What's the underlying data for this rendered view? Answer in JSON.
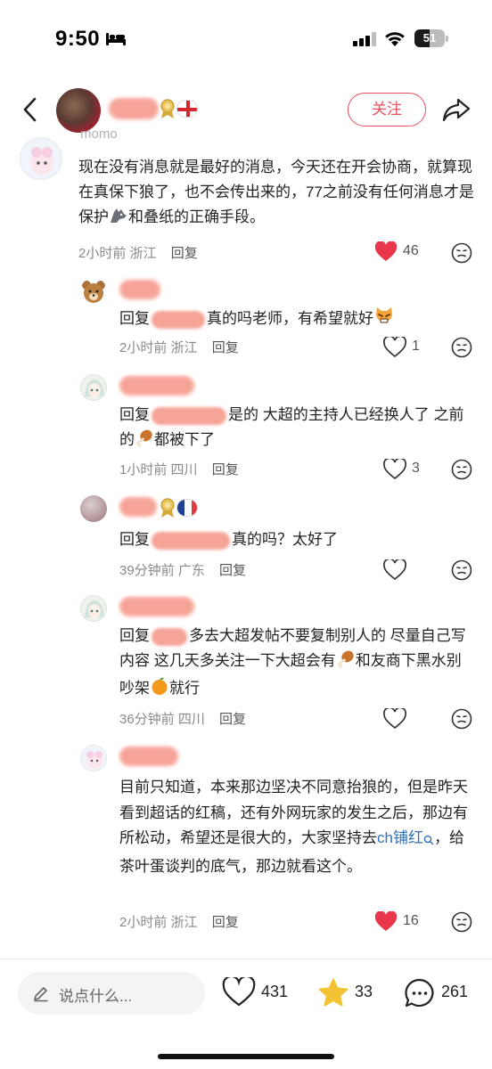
{
  "status_bar": {
    "time": "9:50",
    "battery": "51",
    "battery_level": 0.51
  },
  "header": {
    "follow_label": "关注"
  },
  "comments": [
    {
      "partial_name": "momo",
      "text": "现在没有消息就是最好的消息，今天还在开会协商，就算现在真保下狼了，也不会传出来的，77之前没有任何消息才是保护",
      "text_after_emoji": "和叠纸的正确手段。",
      "time": "2小时前",
      "location": "浙江",
      "reply_label": "回复",
      "likes": "46",
      "liked": true
    },
    {
      "reply_prefix": "回复",
      "text": "真的吗老师，有希望就好",
      "time": "2小时前",
      "location": "浙江",
      "reply_label": "回复",
      "likes": "1",
      "liked": false
    },
    {
      "reply_prefix": "回复",
      "text": "是的 大超的主持人已经换人了 之前的",
      "text_after_emoji": "都被下了",
      "time": "1小时前",
      "location": "四川",
      "reply_label": "回复",
      "likes": "3",
      "liked": false
    },
    {
      "reply_prefix": "回复",
      "text": "真的吗？太好了",
      "time": "39分钟前",
      "location": "广东",
      "reply_label": "回复",
      "likes": "",
      "liked": false
    },
    {
      "reply_prefix": "回复",
      "text": "多去大超发帖不要复制别人的 尽量自己写内容 这几天多关注一下大超会有",
      "text_after_emoji": "和友商下黑水别吵架",
      "text_end": "就行",
      "time": "36分钟前",
      "location": "四川",
      "reply_label": "回复",
      "likes": "",
      "liked": false
    },
    {
      "text": "目前只知道，本来那边坚决不同意抬狼的，但是昨天看到超话的红稿，还有外网玩家的发生之后，那边有所松动，希望还是很大的，大家坚持去",
      "link_text": "ch铺红",
      "text_after_link": "，给茶叶蛋谈判的底气，那边就看这个。",
      "time": "2小时前",
      "location": "浙江",
      "reply_label": "回复",
      "likes": "16",
      "liked": true
    }
  ],
  "bottom_bar": {
    "placeholder": "说点什么...",
    "likes": "431",
    "favorites": "33",
    "comments": "261"
  },
  "colors": {
    "accent": "#e8505b",
    "like_red": "#e8374a",
    "star": "#f3c233",
    "link": "#2f6fb6"
  }
}
